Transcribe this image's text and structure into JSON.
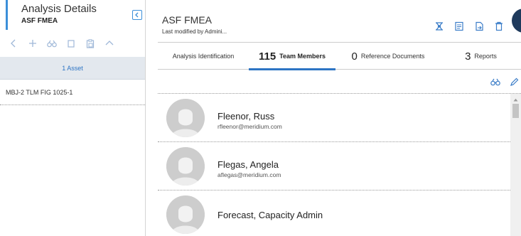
{
  "left_panel": {
    "title": "Analysis Details",
    "subtitle": "ASF FMEA",
    "asset_bar": "1 Asset",
    "assets": [
      "MBJ-2 TLM FIG 1025-1"
    ],
    "toolbar_icons": [
      "chevron-left-icon",
      "plus-icon",
      "binoculars-icon",
      "copy-icon",
      "paste-icon",
      "chevron-up-icon"
    ]
  },
  "main": {
    "title": "ASF FMEA",
    "subtitle": "Last modified by Admini...",
    "actions": [
      "tree-icon",
      "report-icon",
      "export-icon",
      "delete-icon"
    ],
    "tabs": [
      {
        "number": "",
        "label": "Analysis Identification",
        "active": false
      },
      {
        "number": "115",
        "label": "Team Members",
        "active": true
      },
      {
        "number": "0",
        "label": "Reference Documents",
        "active": false
      },
      {
        "number": "3",
        "label": "Reports",
        "active": false
      }
    ],
    "members": [
      {
        "name": "Fleenor, Russ",
        "email": "rfleenor@meridium.com"
      },
      {
        "name": "Flegas, Angela",
        "email": "aflegas@meridium.com"
      },
      {
        "name": "Forecast, Capacity Admin",
        "email": ""
      }
    ]
  },
  "colors": {
    "accent": "#2d74c4",
    "accent_light": "#3b8fd9",
    "asset_bar_bg": "#e3e8ee",
    "corner_button": "#1f3a5c"
  }
}
